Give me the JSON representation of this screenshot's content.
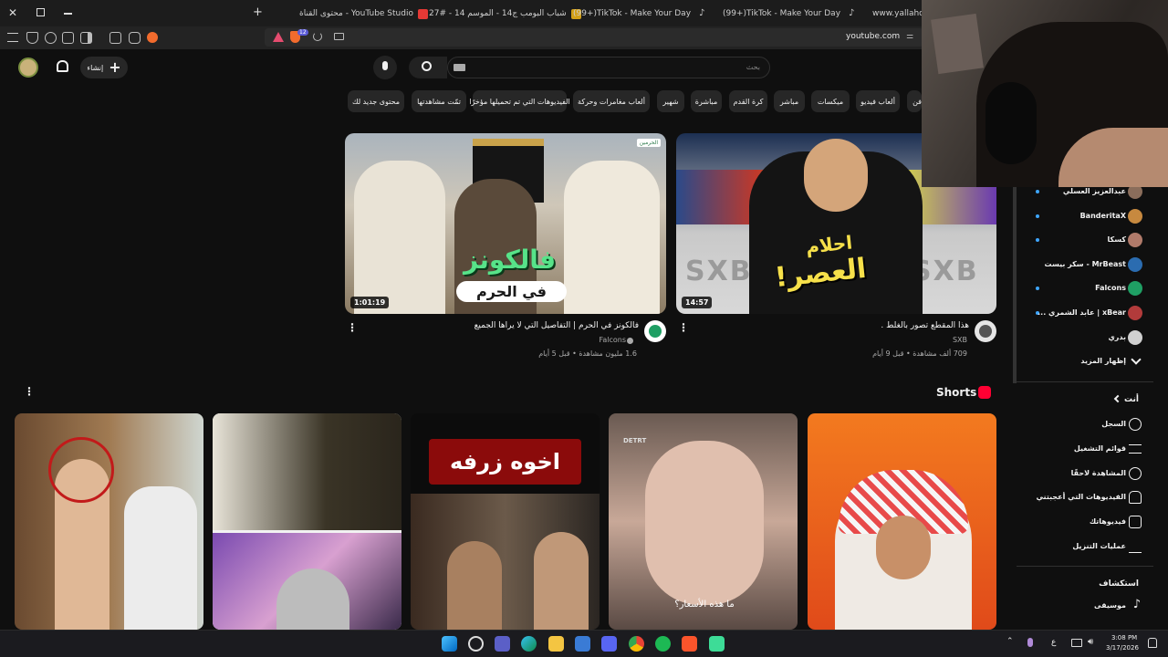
{
  "browser": {
    "tabs": [
      {
        "label": "www.yallahoo.c",
        "icon": "page-icon"
      },
      {
        "label": "(99+)TikTok - Make Your Day",
        "icon": "tiktok-icon"
      },
      {
        "label": "(99+)TikTok - Make Your Day",
        "icon": "tiktok-icon"
      },
      {
        "label": "شباب البومب ج14 - الموسم 14 - #27",
        "icon": "page-icon"
      },
      {
        "label": "محتوى القناة - YouTube Studio",
        "icon": "youtube-studio-icon"
      }
    ],
    "url": "youtube.com",
    "shield_badge": "12"
  },
  "youtube": {
    "create_label": "إنشاء",
    "search_placeholder": "بحث",
    "chips": [
      "محتوى جديد لك",
      "تمّت مشاهدتها",
      "الفيديوهات التي تم تحميلها مؤخرًا",
      "ألعاب مغامرات وحركة",
      "شهير",
      "مباشرة",
      "كرة القدم",
      "مباشر",
      "ميكسات",
      "ألعاب فيديو",
      "فن"
    ],
    "videos": [
      {
        "title": "فالكونز في الحرم | التفاصيل التي لا يراها الجميع",
        "channel": "Falcons",
        "meta": "1.6 مليون مشاهدة • قبل 5 أيام",
        "duration": "1:01:19",
        "thumb_text_1": "فالكونز",
        "thumb_text_2": "في الحرم",
        "thumb_corner": "الحرمين"
      },
      {
        "title": "هذا المقطع تصور بالغلط .",
        "channel": "SXB",
        "meta": "709 ألف مشاهدة • قبل 9 أيام",
        "duration": "14:57",
        "thumb_text_1": "احلام",
        "thumb_text_2": "العصر!",
        "thumb_brand": "SXB"
      }
    ],
    "shorts_title": "Shorts",
    "shorts": [
      {
        "overlay": "",
        "tag": ""
      },
      {
        "overlay": "",
        "tag": ""
      },
      {
        "overlay": "اخوه زرفه",
        "tag": ""
      },
      {
        "overlay": "ما هذه الأسعار؟",
        "tag": "DETRT"
      },
      {
        "overlay": "",
        "tag": ""
      }
    ]
  },
  "sidebar": {
    "subscriptions": [
      {
        "label": "عبدالعزيز العسلي",
        "dot": true,
        "avatar_color": "#8a6d5b"
      },
      {
        "label": "BanderitaX",
        "dot": true,
        "avatar_color": "#c7893f"
      },
      {
        "label": "كسكا",
        "dot": true,
        "avatar_color": "#b07a6a"
      },
      {
        "label": "MrBeast - سكر بيست",
        "dot": false,
        "avatar_color": "#2b6cb0"
      },
      {
        "label": "Falcons",
        "dot": true,
        "avatar_color": "#1f9f64"
      },
      {
        "label": "xBear | عابد الشمري ...",
        "dot": true,
        "avatar_color": "#b23b3b"
      },
      {
        "label": "بدري",
        "dot": false,
        "avatar_color": "#d0d0d0"
      }
    ],
    "show_more": "إظهار المزيد",
    "you_header": "أنت",
    "you_items": [
      {
        "label": "السجل",
        "icon": "history-icon"
      },
      {
        "label": "قوائم التشغيل",
        "icon": "playlists-icon"
      },
      {
        "label": "المشاهدة لاحقًا",
        "icon": "watch-later-icon"
      },
      {
        "label": "الفيديوهات التي أعجبتني",
        "icon": "like-icon"
      },
      {
        "label": "فيديوهاتك",
        "icon": "your-videos-icon"
      },
      {
        "label": "عمليات التنزيل",
        "icon": "download-icon"
      }
    ],
    "explore_header": "استكشاف",
    "explore_items": [
      {
        "label": "موسيقى",
        "icon": "music-icon"
      }
    ]
  },
  "taskbar": {
    "time": "3:08 PM",
    "date": "3/17/2026",
    "lang": "ع"
  }
}
